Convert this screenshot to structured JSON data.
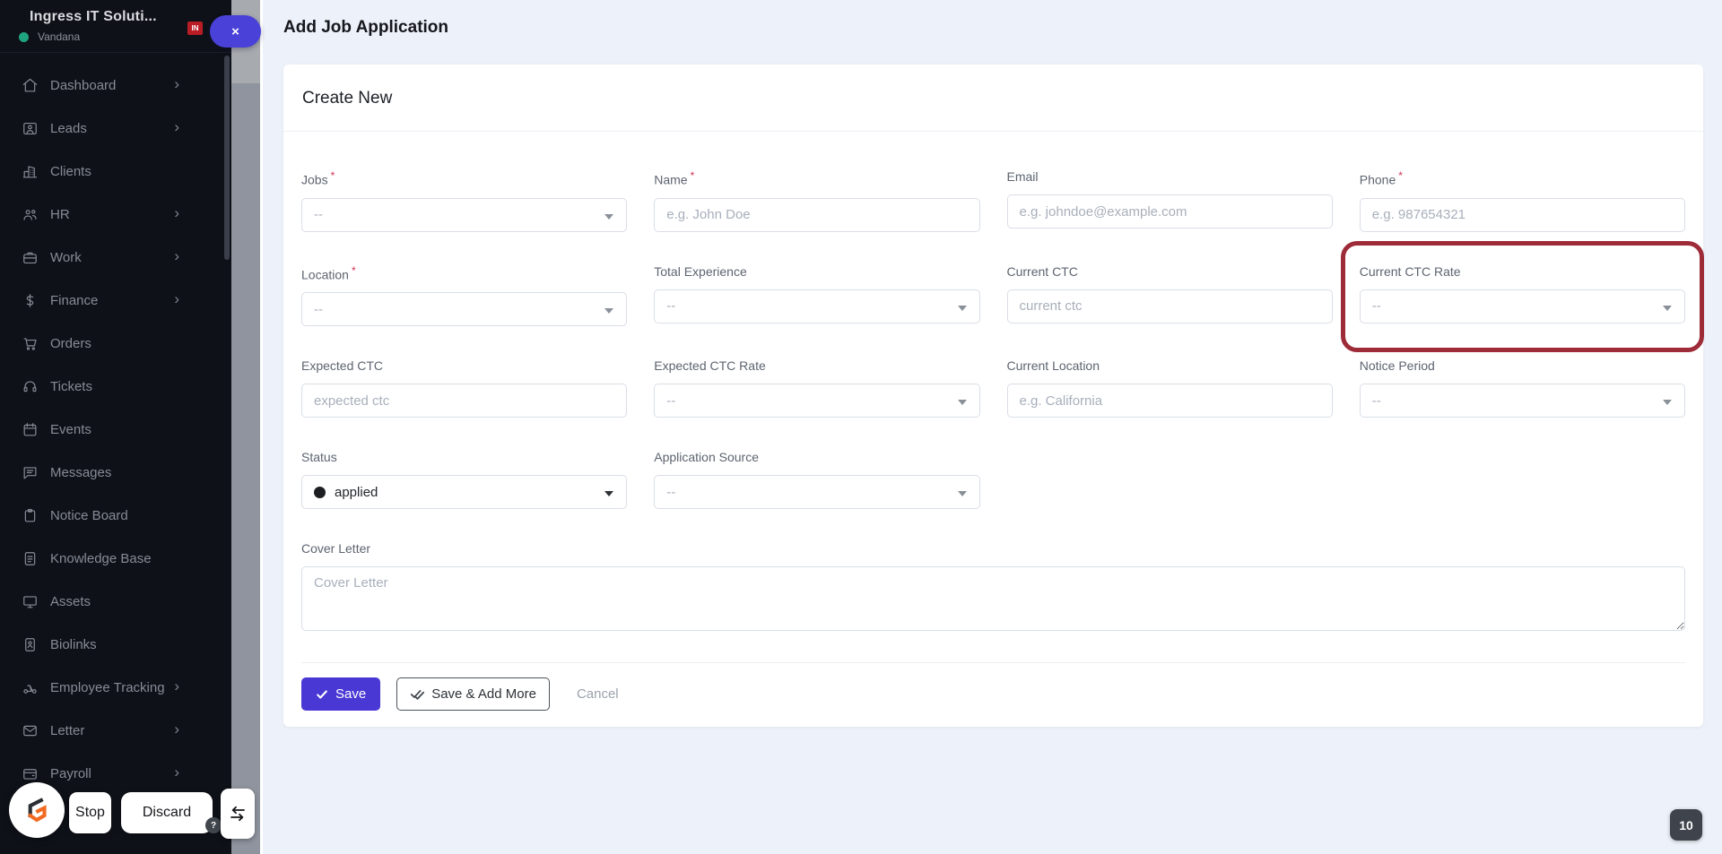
{
  "sidebar": {
    "org_name": "Ingress IT Soluti...",
    "org_logo_text": "IN",
    "user_name": "Vandana",
    "items": [
      {
        "label": "Dashboard",
        "chevron": "›"
      },
      {
        "label": "Leads",
        "chevron": "›"
      },
      {
        "label": "Clients",
        "chevron": ""
      },
      {
        "label": "HR",
        "chevron": "›"
      },
      {
        "label": "Work",
        "chevron": "›"
      },
      {
        "label": "Finance",
        "chevron": "›"
      },
      {
        "label": "Orders",
        "chevron": ""
      },
      {
        "label": "Tickets",
        "chevron": ""
      },
      {
        "label": "Events",
        "chevron": ""
      },
      {
        "label": "Messages",
        "chevron": ""
      },
      {
        "label": "Notice Board",
        "chevron": ""
      },
      {
        "label": "Knowledge Base",
        "chevron": ""
      },
      {
        "label": "Assets",
        "chevron": ""
      },
      {
        "label": "Biolinks",
        "chevron": ""
      },
      {
        "label": "Employee Tracking",
        "chevron": "›"
      },
      {
        "label": "Letter",
        "chevron": "›"
      },
      {
        "label": "Payroll",
        "chevron": "›"
      }
    ]
  },
  "topbar": {
    "close_label": "×"
  },
  "page": {
    "title": "Add Job Application"
  },
  "card": {
    "title": "Create New"
  },
  "form": {
    "jobs": {
      "label": "Jobs",
      "required": "*",
      "value": "--"
    },
    "name": {
      "label": "Name",
      "required": "*",
      "placeholder": "e.g. John Doe"
    },
    "email": {
      "label": "Email",
      "placeholder": "e.g. johndoe@example.com"
    },
    "phone": {
      "label": "Phone",
      "required": "*",
      "placeholder": "e.g. 987654321"
    },
    "location": {
      "label": "Location",
      "required": "*",
      "value": "--"
    },
    "total_experience": {
      "label": "Total Experience",
      "value": "--"
    },
    "current_ctc": {
      "label": "Current CTC",
      "placeholder": "current ctc"
    },
    "current_ctc_rate": {
      "label": "Current CTC Rate",
      "value": "--"
    },
    "expected_ctc": {
      "label": "Expected CTC",
      "placeholder": "expected ctc"
    },
    "expected_ctc_rate": {
      "label": "Expected CTC Rate",
      "value": "--"
    },
    "current_location": {
      "label": "Current Location",
      "placeholder": "e.g. California"
    },
    "notice_period": {
      "label": "Notice Period",
      "value": "--"
    },
    "status": {
      "label": "Status",
      "value": "applied"
    },
    "application_source": {
      "label": "Application Source",
      "value": "--"
    },
    "cover_letter": {
      "label": "Cover Letter",
      "placeholder": "Cover Letter"
    },
    "buttons": {
      "save": "Save",
      "save_add_more": "Save & Add More",
      "cancel": "Cancel"
    }
  },
  "overlay": {
    "stop": "Stop",
    "discard": "Discard",
    "help": "?",
    "page_badge": "10"
  },
  "colors": {
    "accent": "#4a38d4",
    "highlight_ring": "#9e2b38",
    "status_green": "#1fa57e",
    "sidebar_bg": "#0e1118"
  }
}
